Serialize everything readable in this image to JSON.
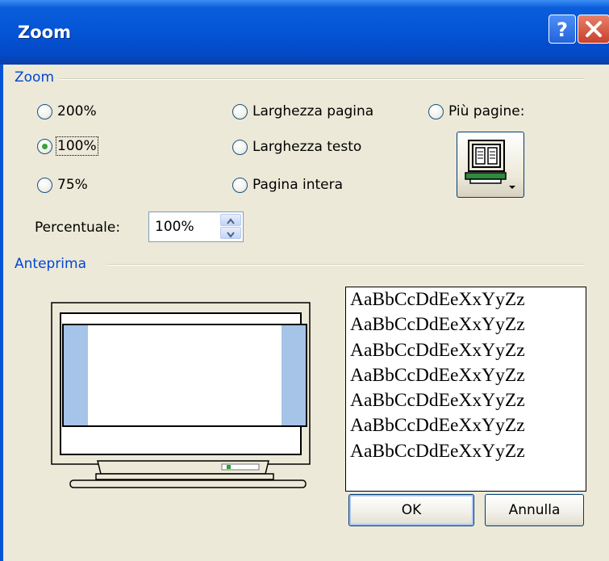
{
  "window": {
    "title": "Zoom"
  },
  "zoom_group": {
    "label": "Zoom"
  },
  "options": {
    "z200": "200%",
    "z100": "100%",
    "z75": "75%",
    "page_width": "Larghezza pagina",
    "text_width": "Larghezza testo",
    "whole_page": "Pagina intera",
    "many_pages": "Più pagine:"
  },
  "selected_option": "100%",
  "percent": {
    "label": "Percentuale:",
    "value": "100%"
  },
  "preview_group": {
    "label": "Anteprima"
  },
  "sample_text": [
    "AaBbCcDdEeXxYyZz",
    "AaBbCcDdEeXxYyZz",
    "AaBbCcDdEeXxYyZz",
    "AaBbCcDdEeXxYyZz",
    "AaBbCcDdEeXxYyZz",
    "AaBbCcDdEeXxYyZz",
    "AaBbCcDdEeXxYyZz"
  ],
  "buttons": {
    "ok": "OK",
    "cancel": "Annulla"
  },
  "icons": {
    "help": "help-icon",
    "close": "close-icon",
    "many_pages": "monitor-pages-icon",
    "preview": "monitor-preview-icon"
  },
  "colors": {
    "title_bar": "#0454D6",
    "group_label": "#0046D5",
    "dialog_bg": "#ECE9D8",
    "radio_selected": "#3AA33F"
  }
}
